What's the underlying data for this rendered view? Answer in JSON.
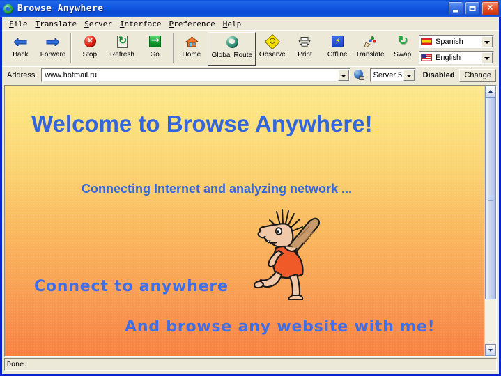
{
  "window": {
    "title": "Browse Anywhere",
    "app_icon": "globe-icon",
    "minimize_label": "Minimize",
    "maximize_label": "Maximize",
    "close_label": "Close",
    "close_glyph": "✕"
  },
  "menu": {
    "items": [
      {
        "name": "file",
        "accel": "F",
        "rest": "ile"
      },
      {
        "name": "translate",
        "accel": "T",
        "rest": "ranslate"
      },
      {
        "name": "server",
        "accel": "S",
        "rest": "erver"
      },
      {
        "name": "interface",
        "accel": "I",
        "rest": "nterface"
      },
      {
        "name": "preference",
        "accel": "P",
        "rest": "reference"
      },
      {
        "name": "help",
        "accel": "H",
        "rest": "elp"
      }
    ]
  },
  "toolbar": {
    "buttons": [
      {
        "name": "back",
        "label": "Back",
        "icon": "back-arrow-icon"
      },
      {
        "name": "forward",
        "label": "Forward",
        "icon": "forward-arrow-icon"
      },
      {
        "name": "stop",
        "label": "Stop",
        "icon": "stop-icon"
      },
      {
        "name": "refresh",
        "label": "Refresh",
        "icon": "refresh-icon"
      },
      {
        "name": "go",
        "label": "Go",
        "icon": "go-arrow-icon"
      },
      {
        "name": "home",
        "label": "Home",
        "icon": "home-icon"
      },
      {
        "name": "global-route",
        "label": "Global Route",
        "icon": "globe-icon"
      },
      {
        "name": "observe",
        "label": "Observe",
        "icon": "observe-face-icon"
      },
      {
        "name": "print",
        "label": "Print",
        "icon": "printer-icon"
      },
      {
        "name": "offline",
        "label": "Offline",
        "icon": "lightning-icon"
      },
      {
        "name": "translate",
        "label": "Translate",
        "icon": "translate-icon"
      },
      {
        "name": "swap",
        "label": "Swap",
        "icon": "swap-refresh-icon"
      }
    ],
    "language_from": {
      "label": "Spanish",
      "flag": "spain-flag-icon"
    },
    "language_to": {
      "label": "English",
      "flag": "usa-flag-icon"
    }
  },
  "address": {
    "label": "Address",
    "url": "www.hotmail.ru",
    "placeholder": "",
    "net_icon": "globe-connection-icon",
    "server": "Server 5",
    "status": "Disabled",
    "change_label": "Change"
  },
  "content": {
    "headline": "Welcome to Browse Anywhere!",
    "subline": "Connecting Internet and analyzing network ...",
    "tagline1": "Connect to anywhere",
    "tagline2": "And browse any website with me!",
    "image_alt": "caveman-with-club-illustration",
    "text_color": "#3366DD",
    "bg_top_color": "#FBE88C",
    "bg_bottom_color": "#F7823F"
  },
  "statusbar": {
    "text": "Done."
  }
}
